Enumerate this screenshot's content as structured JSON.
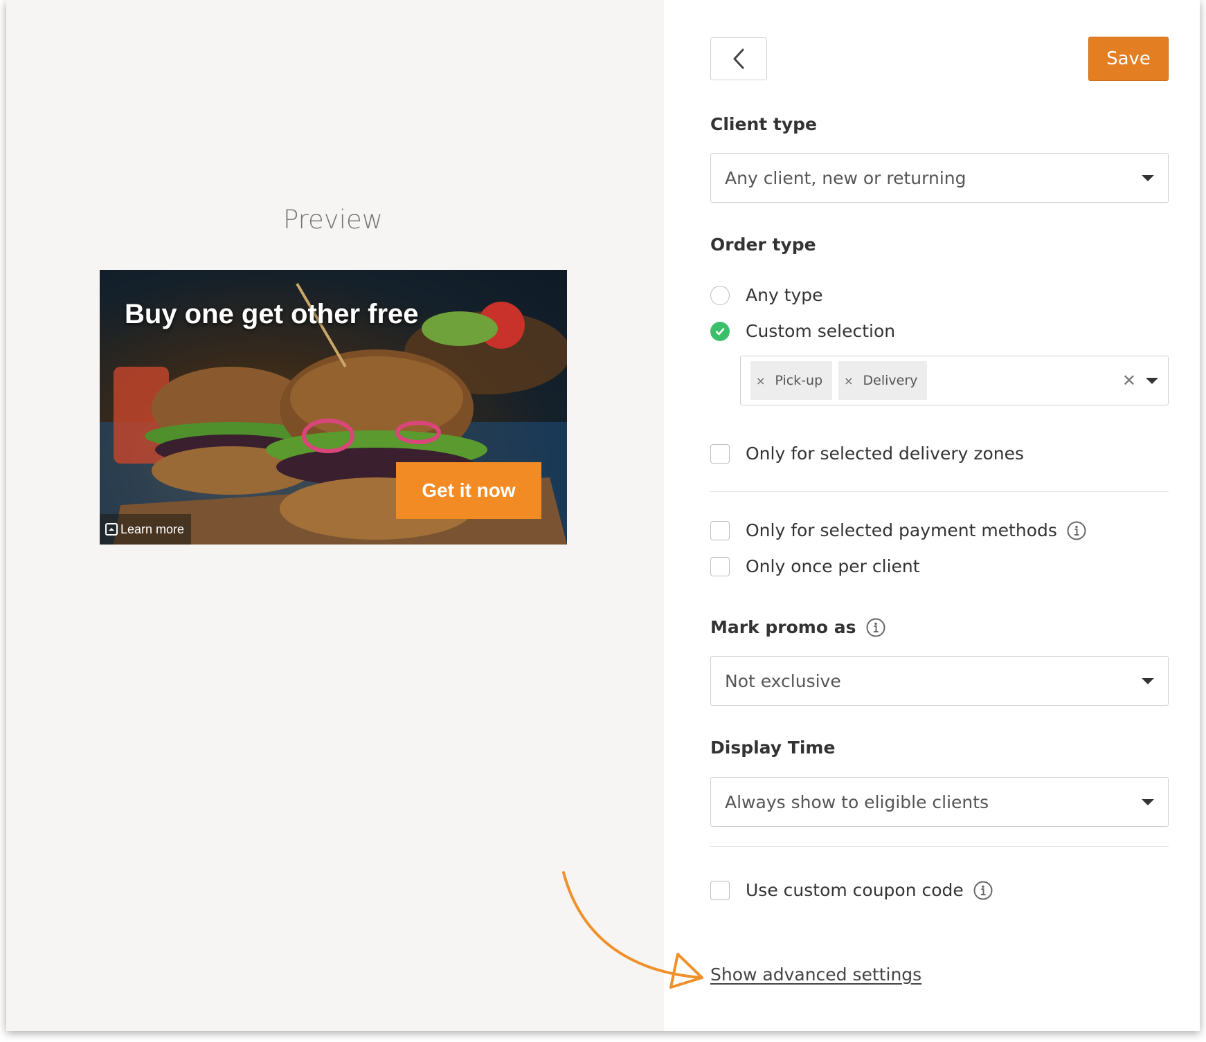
{
  "preview": {
    "title": "Preview",
    "banner": {
      "headline": "Buy one get other free",
      "cta_label": "Get it now",
      "learn_more_label": "Learn more"
    }
  },
  "toolbar": {
    "back_icon": "chevron-left-icon",
    "save_label": "Save",
    "accent_color": "#e47e22"
  },
  "client_type": {
    "label": "Client type",
    "selected": "Any client, new or returning"
  },
  "order_type": {
    "label": "Order type",
    "options": [
      {
        "label": "Any type",
        "selected": false
      },
      {
        "label": "Custom selection",
        "selected": true
      }
    ],
    "selected_types": [
      "Pick-up",
      "Delivery"
    ],
    "chip_remove_glyph": "×",
    "clear_glyph": "✕",
    "selected_color": "#3bbf6a"
  },
  "restrictions": {
    "delivery_zones": {
      "label": "Only for selected delivery zones",
      "checked": false
    },
    "payment_methods": {
      "label": "Only for selected payment methods",
      "checked": false
    },
    "once_per_client": {
      "label": "Only once per client",
      "checked": false
    }
  },
  "mark_promo": {
    "label": "Mark promo as",
    "selected": "Not exclusive"
  },
  "display_time": {
    "label": "Display Time",
    "selected": "Always show to eligible clients"
  },
  "coupon": {
    "label": "Use custom coupon code",
    "checked": false
  },
  "advanced_link": "Show advanced settings"
}
